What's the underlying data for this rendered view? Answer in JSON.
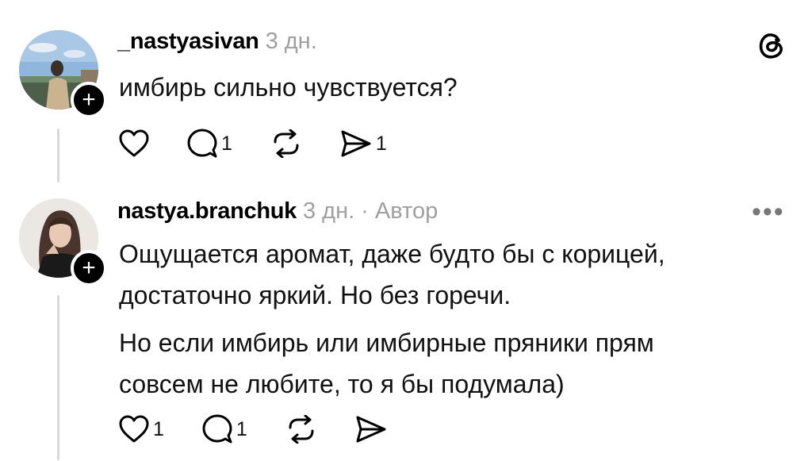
{
  "posts": [
    {
      "username": "_nastyasivan",
      "time": "3 дн.",
      "author_tag": "",
      "lines": [
        "имбирь сильно чувствуется?"
      ],
      "likes": "",
      "replies": "1",
      "shares": "1",
      "follow_symbol": "+"
    },
    {
      "username": "nastya.branchuk",
      "time": "3 дн.",
      "author_tag": "· Автор",
      "lines": [
        "Ощущается аромат, даже будто бы с корицей,",
        "достаточно яркий. Но без горечи.",
        "Но если имбирь или имбирные пряники прям",
        "совсем не любите, то я бы подумала)"
      ],
      "likes": "1",
      "replies": "1",
      "shares": "",
      "follow_symbol": "+"
    }
  ],
  "icons": {
    "top_right": "threads-logo-icon",
    "more": "more-options-icon",
    "more_glyph": "•••",
    "like": "heart-icon",
    "reply": "comment-icon",
    "repost": "repost-icon",
    "share": "send-icon"
  }
}
